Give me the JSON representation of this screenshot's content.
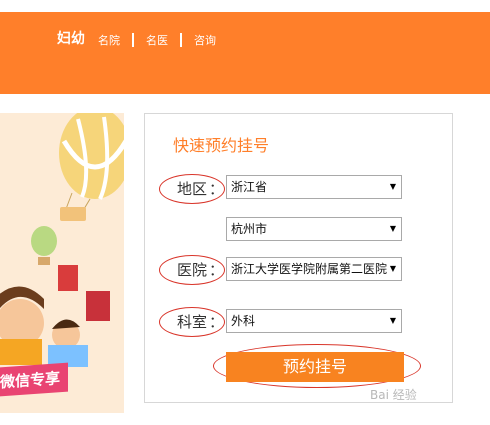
{
  "header": {
    "brand": "妇幼",
    "nav": [
      "名院",
      "名医",
      "咨询"
    ]
  },
  "banner": {
    "text": "微信专享"
  },
  "form": {
    "title": "快速预约挂号",
    "region_label": "地区",
    "hospital_label": "医院",
    "dept_label": "科室",
    "colon": "：",
    "province": "浙江省",
    "city": "杭州市",
    "hospital": "浙江大学医学院附属第二医院",
    "department": "外科",
    "submit_label": "预约挂号"
  },
  "watermark": "Bai 经验",
  "colors": {
    "accent": "#ff7f2a",
    "annotation": "#d9362b"
  },
  "icons": {
    "dropdown": "triangle-down"
  }
}
